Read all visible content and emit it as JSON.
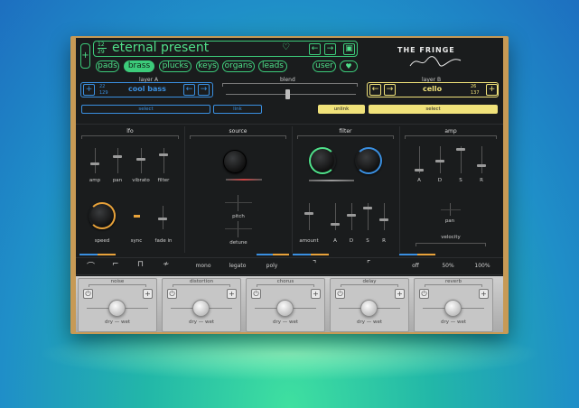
{
  "preset": {
    "index": "12",
    "total": "29",
    "name": "eternal present"
  },
  "brand": {
    "line1": "THE FRINGE"
  },
  "categories": [
    "pads",
    "brass",
    "plucks",
    "keys",
    "organs",
    "leads"
  ],
  "selected_category": "brass",
  "user_label": "user",
  "layerA": {
    "title": "layer A",
    "index": "22",
    "total": "129",
    "name": "cool bass",
    "select": "select",
    "link": "link"
  },
  "blend": {
    "title": "blend",
    "value": 0.5
  },
  "layerB": {
    "title": "layer B",
    "index": "26",
    "total": "137",
    "name": "cello",
    "unlink": "unlink",
    "select": "select"
  },
  "sections": {
    "lfo": "lfo",
    "source": "source",
    "filter": "filter",
    "amp": "amp"
  },
  "lfo_labels": [
    "amp",
    "pan",
    "vibrato",
    "filter",
    "speed",
    "sync",
    "fade in"
  ],
  "source_labels": [
    "pitch",
    "detune"
  ],
  "filter_labels": [
    "amount",
    "A",
    "D",
    "S",
    "R"
  ],
  "amp_labels": [
    "A",
    "D",
    "S",
    "R",
    "pan",
    "velocity"
  ],
  "bottom_labels": [
    "mono",
    "legato",
    "poly",
    "off",
    "50%",
    "100%"
  ],
  "fx": [
    {
      "name": "noise",
      "mix": "dry — wet"
    },
    {
      "name": "distortion",
      "mix": "dry — wet"
    },
    {
      "name": "chorus",
      "mix": "dry — wet"
    },
    {
      "name": "delay",
      "mix": "dry — wet"
    },
    {
      "name": "reverb",
      "mix": "dry — wet"
    }
  ],
  "colors": {
    "green": "#3ccb7a",
    "blue": "#3a8fe0",
    "yellow": "#f0e27a",
    "amber": "#e8a23a"
  }
}
